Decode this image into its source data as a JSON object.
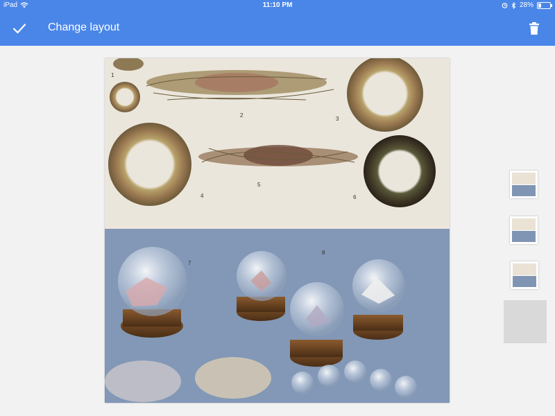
{
  "status_bar": {
    "device": "iPad",
    "time": "11:10 PM",
    "battery_percent_label": "28%",
    "battery_level": 0.28
  },
  "app_bar": {
    "title": "Change layout",
    "confirm_icon": "check-icon",
    "delete_icon": "trash-icon"
  },
  "photo": {
    "labels": [
      "1",
      "2",
      "3",
      "4",
      "5",
      "6",
      "7",
      "8"
    ]
  },
  "layout_options": {
    "count": 3,
    "selected_index": 2
  },
  "colors": {
    "accent": "#4a86e8",
    "background": "#f2f2f2"
  }
}
